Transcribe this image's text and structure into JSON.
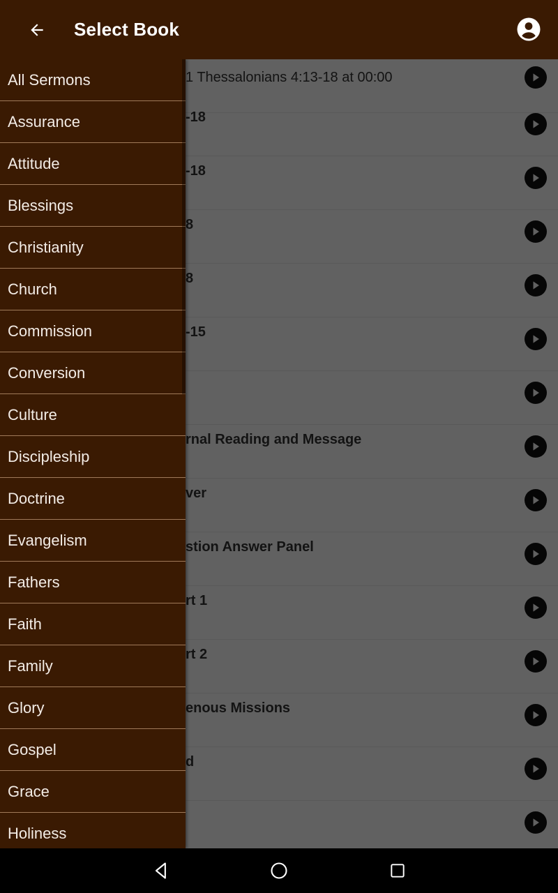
{
  "appbar": {
    "title": "Select Book",
    "back_icon": "arrow-left-icon",
    "account_icon": "account-circle-icon"
  },
  "colors": {
    "primary": "#3a1a02",
    "drawer_divider": "#a07a5a",
    "drawer_text": "#f3ece6",
    "scrim": "rgba(0,0,0,0.62)",
    "play_button": "#111111"
  },
  "sermon_list": [
    {
      "visible_text": "1 Thessalonians 4:13-18 at 00:00"
    },
    {
      "visible_text": "-18"
    },
    {
      "visible_text": "-18"
    },
    {
      "visible_text": "8"
    },
    {
      "visible_text": "8"
    },
    {
      "visible_text": "-15"
    },
    {
      "visible_text": ""
    },
    {
      "visible_text": "rnal Reading and Message"
    },
    {
      "visible_text": "ver"
    },
    {
      "visible_text": "stion Answer Panel"
    },
    {
      "visible_text": "rt 1"
    },
    {
      "visible_text": "rt 2"
    },
    {
      "visible_text": "enous Missions"
    },
    {
      "visible_text": "d"
    },
    {
      "visible_text": ""
    }
  ],
  "drawer": {
    "items": [
      {
        "label": "All Sermons"
      },
      {
        "label": "Assurance"
      },
      {
        "label": "Attitude"
      },
      {
        "label": "Blessings"
      },
      {
        "label": "Christianity"
      },
      {
        "label": "Church"
      },
      {
        "label": "Commission"
      },
      {
        "label": "Conversion"
      },
      {
        "label": "Culture"
      },
      {
        "label": "Discipleship"
      },
      {
        "label": "Doctrine"
      },
      {
        "label": "Evangelism"
      },
      {
        "label": "Fathers"
      },
      {
        "label": "Faith"
      },
      {
        "label": "Family"
      },
      {
        "label": "Glory"
      },
      {
        "label": "Gospel"
      },
      {
        "label": "Grace"
      },
      {
        "label": "Holiness"
      }
    ]
  },
  "navbar": {
    "back_icon": "nav-back-icon",
    "home_icon": "nav-home-icon",
    "recents_icon": "nav-recents-icon"
  }
}
